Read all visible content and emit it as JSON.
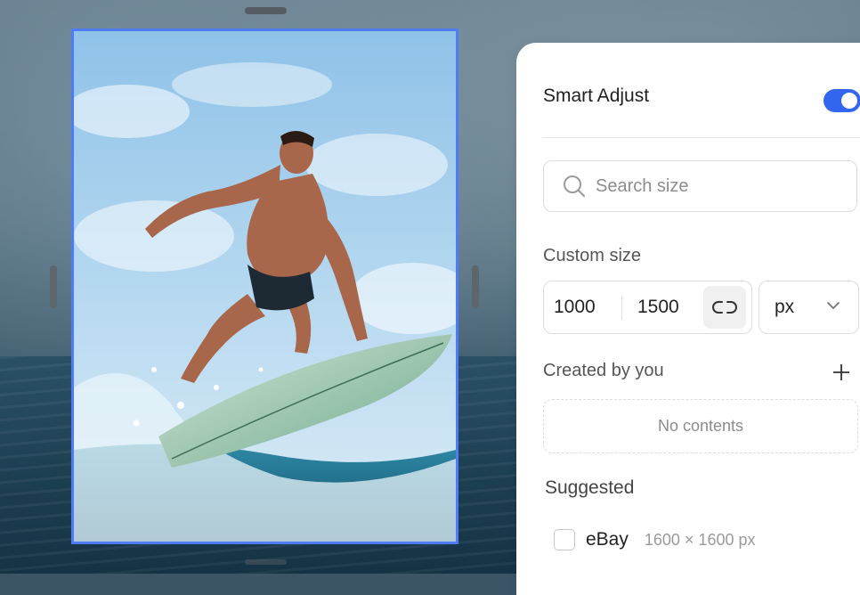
{
  "canvas": {
    "image_desc_icon": "surfer-photo"
  },
  "panel": {
    "smart_adjust": {
      "label": "Smart Adjust",
      "enabled": true
    },
    "search": {
      "placeholder": "Search size"
    },
    "custom_size": {
      "label": "Custom size",
      "width": "1000",
      "height": "1500",
      "unit": "px"
    },
    "created_by_you": {
      "label": "Created by you",
      "empty_text": "No contents"
    },
    "suggested": {
      "label": "Suggested",
      "items": [
        {
          "name": "eBay",
          "dimensions": "1600 × 1600 px"
        }
      ]
    }
  },
  "colors": {
    "accent": "#3366f0",
    "frame": "#4e7cf6"
  }
}
